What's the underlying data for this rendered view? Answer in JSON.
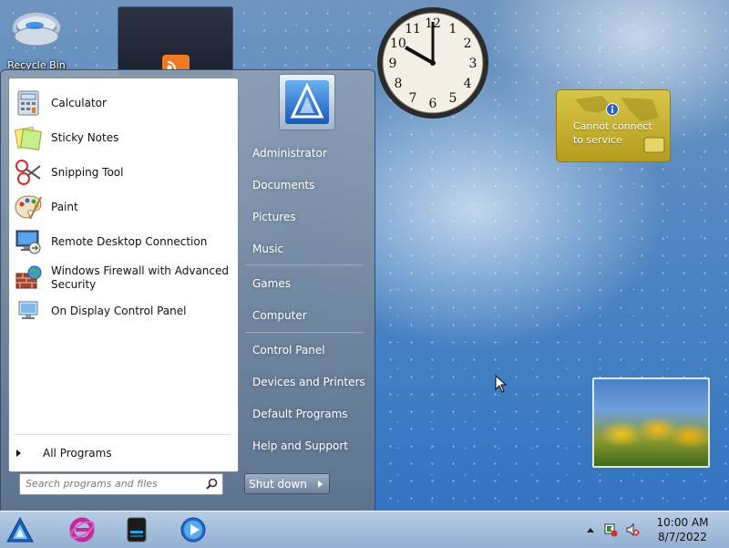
{
  "desktop": {
    "recycle_bin_label": "Recycle Bin"
  },
  "gadgets": {
    "clock": {
      "time": "10:00",
      "hour_labels": [
        "12",
        "1",
        "2",
        "3",
        "4",
        "5",
        "6",
        "7",
        "8",
        "9",
        "10",
        "11"
      ]
    },
    "weather": {
      "message": "Cannot connect to service",
      "line1": "Cannot connect",
      "line2": "to service"
    }
  },
  "start_menu": {
    "pinned_programs": [
      {
        "label": "Calculator",
        "icon": "calculator-icon"
      },
      {
        "label": "Sticky Notes",
        "icon": "sticky-notes-icon"
      },
      {
        "label": "Snipping Tool",
        "icon": "scissors-icon"
      },
      {
        "label": "Paint",
        "icon": "paint-palette-icon"
      },
      {
        "label": "Remote Desktop Connection",
        "icon": "remote-desktop-icon"
      },
      {
        "label": "Windows Firewall with Advanced Security",
        "line1": "Windows Firewall with Advanced",
        "line2": "Security",
        "icon": "firewall-icon"
      },
      {
        "label": "On Display Control Panel",
        "icon": "display-panel-icon"
      }
    ],
    "all_programs_label": "All Programs",
    "search": {
      "placeholder": "Search programs and files",
      "value": ""
    },
    "right_links": {
      "administrator": "Administrator",
      "documents": "Documents",
      "pictures": "Pictures",
      "music": "Music",
      "games": "Games",
      "computer": "Computer",
      "control_panel": "Control Panel",
      "devices_printers": "Devices and Printers",
      "default_programs": "Default Programs",
      "help_support": "Help and Support"
    },
    "shutdown_label": "Shut down"
  },
  "taskbar": {
    "pinned": [
      "start-orb-icon",
      "internet-explorer-icon",
      "explorer-icon",
      "media-player-icon"
    ],
    "tray": {
      "time": "10:00 AM",
      "date": "8/7/2022"
    }
  },
  "colors": {
    "taskbar": "#a9c2df",
    "start_menu_right": "#6f8399",
    "weather_gadget": "#c8b430"
  }
}
